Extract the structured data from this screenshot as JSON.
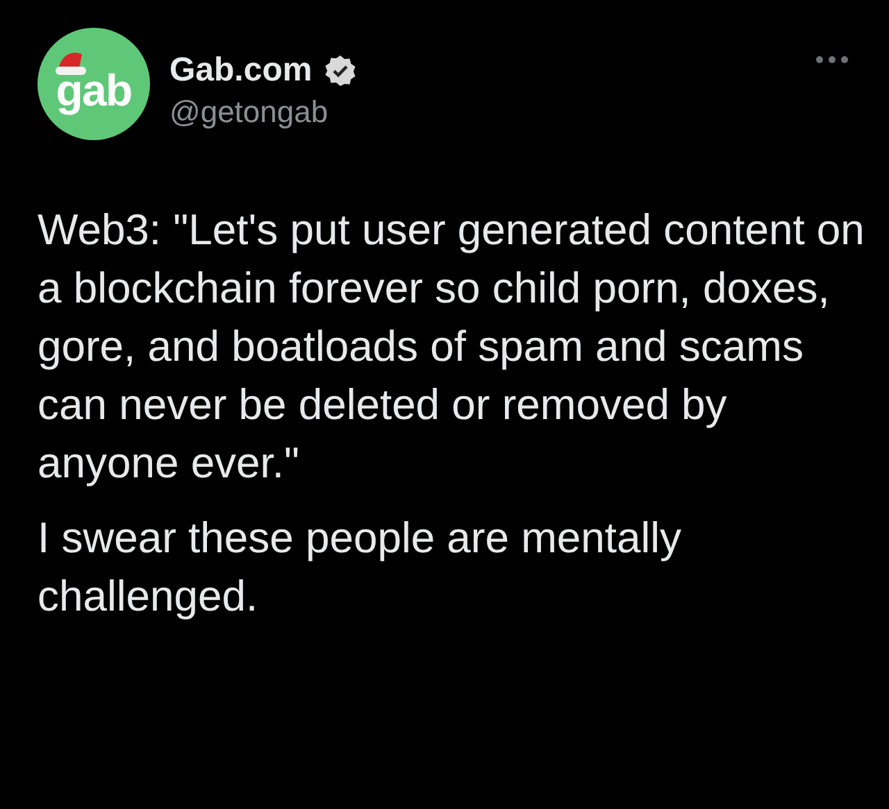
{
  "author": {
    "avatar_text": "gab",
    "name": "Gab.com",
    "verified": true,
    "handle": "@getongab"
  },
  "paragraphs": [
    "Web3: \"Let's put user generated content on a blockchain forever so child porn, doxes, gore, and boatloads of spam and scams can never be deleted or removed by anyone ever.\"",
    "I swear these people are mentally challenged."
  ]
}
